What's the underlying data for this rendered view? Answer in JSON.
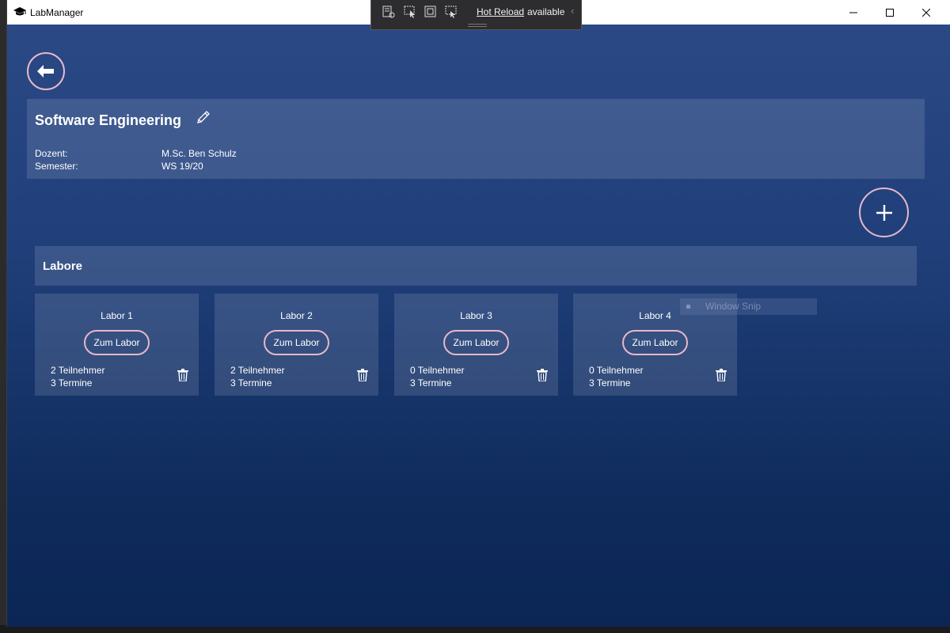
{
  "window": {
    "title": "LabManager"
  },
  "hot_reload": {
    "link_label": "Hot Reload",
    "status_text": "available",
    "collapse_glyph": "‹"
  },
  "course": {
    "title": "Software Engineering",
    "lecturer_label": "Dozent:",
    "lecturer_value": "M.Sc. Ben Schulz",
    "semester_label": "Semester:",
    "semester_value": "WS 19/20"
  },
  "labs_section": {
    "title": "Labore",
    "open_label": "Zum Labor",
    "items": [
      {
        "name": "Labor 1",
        "participants": "2 Teilnehmer",
        "dates": "3 Termine"
      },
      {
        "name": "Labor 2",
        "participants": "2 Teilnehmer",
        "dates": "3 Termine"
      },
      {
        "name": "Labor 3",
        "participants": "0 Teilnehmer",
        "dates": "3 Termine"
      },
      {
        "name": "Labor 4",
        "participants": "0 Teilnehmer",
        "dates": "3 Termine"
      }
    ]
  },
  "overlay": {
    "snip_label": "Window Snip"
  },
  "colors": {
    "accent_ring": "#e7b8c8",
    "background_top": "#2b4a86",
    "background_bottom": "#0b2654"
  },
  "icons": {
    "back": "arrow-left-icon",
    "edit": "pencil-icon",
    "add": "plus-icon",
    "delete": "trash-icon",
    "app": "graduation-cap-icon"
  }
}
